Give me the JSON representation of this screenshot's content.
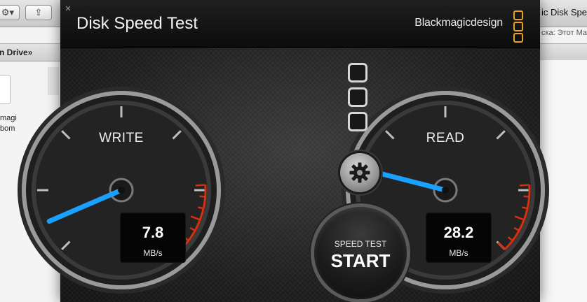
{
  "finder": {
    "path_text": "n Drive»",
    "file_name_line1": "magi",
    "file_name_line2": "bom",
    "right_title": "ic Disk Speed",
    "right_subtitle": "ска: Этот Ма"
  },
  "app": {
    "title": "Disk Speed Test",
    "brand": "Blackmagicdesign",
    "accent_color": "#f0a020",
    "needle_color": "#1aa0ff",
    "redline_color": "#d63010"
  },
  "write_gauge": {
    "label": "WRITE",
    "value": "7.8",
    "unit": "MB/s",
    "needle_fraction": 0.08
  },
  "read_gauge": {
    "label": "READ",
    "value": "28.2",
    "unit": "MB/s",
    "needle_fraction": 0.22
  },
  "start_button": {
    "small_label": "SPEED TEST",
    "big_label": "START"
  }
}
